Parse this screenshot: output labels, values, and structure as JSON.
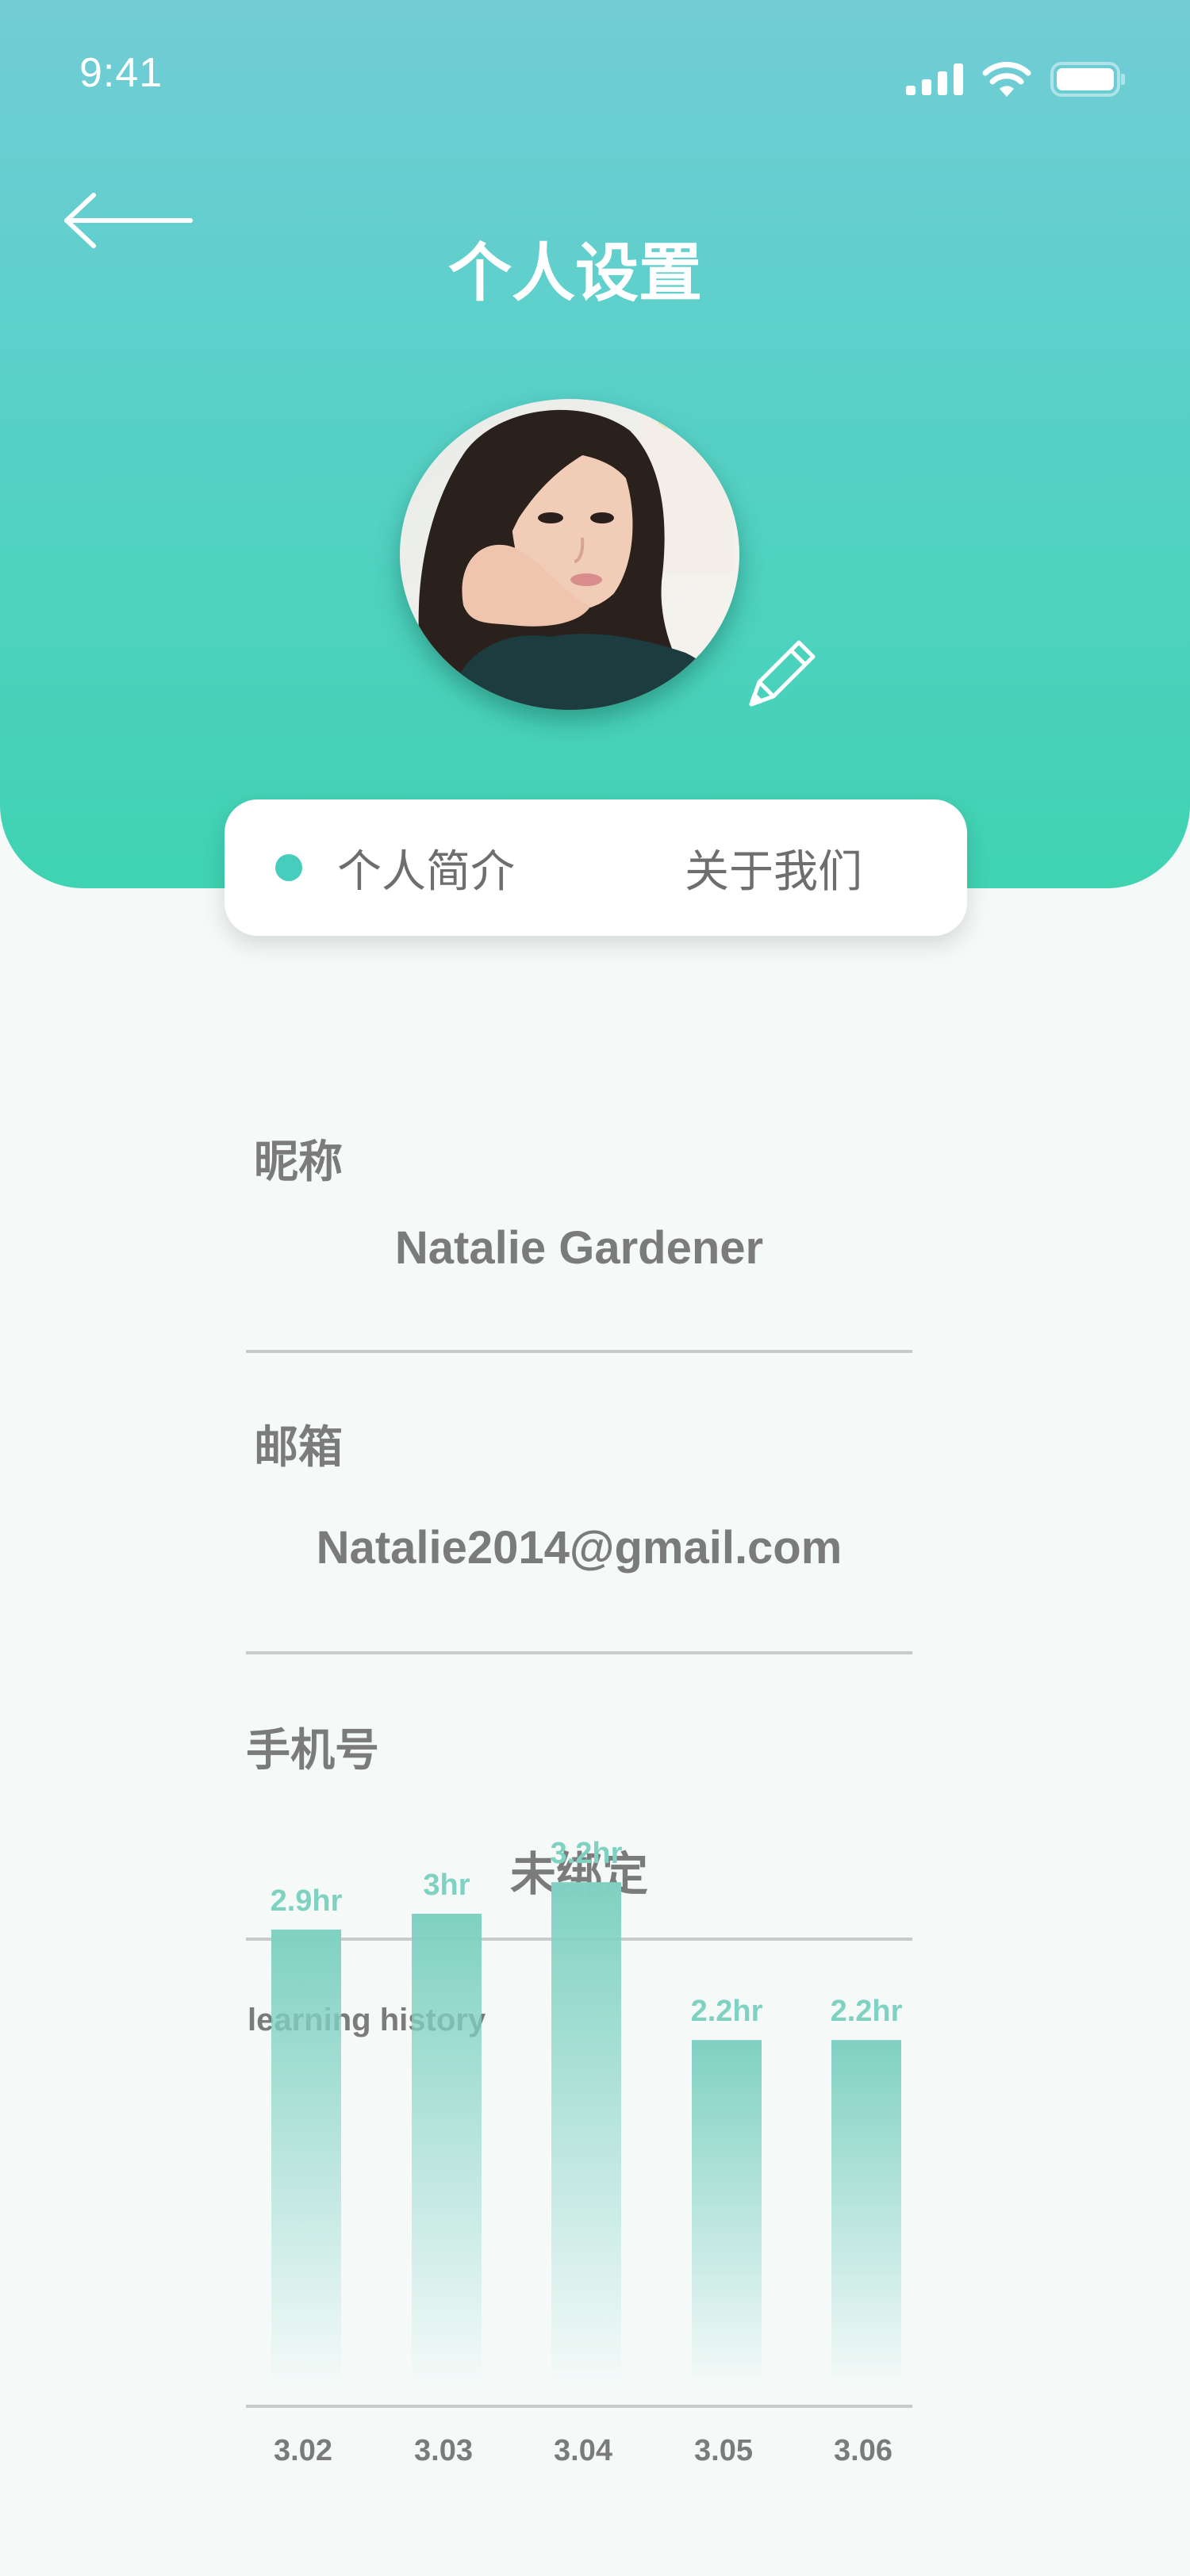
{
  "status_bar": {
    "time": "9:41",
    "icons": [
      "signal-icon",
      "wifi-icon",
      "battery-icon"
    ]
  },
  "header": {
    "title": "个人设置",
    "back_icon": "back-arrow-icon",
    "edit_icon": "pencil-icon"
  },
  "tabs": [
    {
      "label": "个人简介",
      "active": true
    },
    {
      "label": "关于我们",
      "active": false
    }
  ],
  "fields": {
    "nickname": {
      "label": "昵称",
      "value": "Natalie Gardener"
    },
    "email": {
      "label": "邮箱",
      "value": "Natalie2014@gmail.com"
    },
    "phone": {
      "label": "手机号",
      "value": "未绑定"
    }
  },
  "colors": {
    "accent": "#46cdbd",
    "header_top": "#72ccd6",
    "header_bottom": "#3fd3b2",
    "text": "#7b7b7b"
  },
  "chart_data": {
    "type": "bar",
    "title": "learning history",
    "categories": [
      "3.02",
      "3.03",
      "3.04",
      "3.05",
      "3.06"
    ],
    "values": [
      2.9,
      3.0,
      3.2,
      2.2,
      2.2
    ],
    "data_labels": [
      "2.9hr",
      "3hr",
      "3.2hr",
      "2.2hr",
      "2.2hr"
    ],
    "xlabel": "",
    "ylabel": "",
    "grid": false
  }
}
